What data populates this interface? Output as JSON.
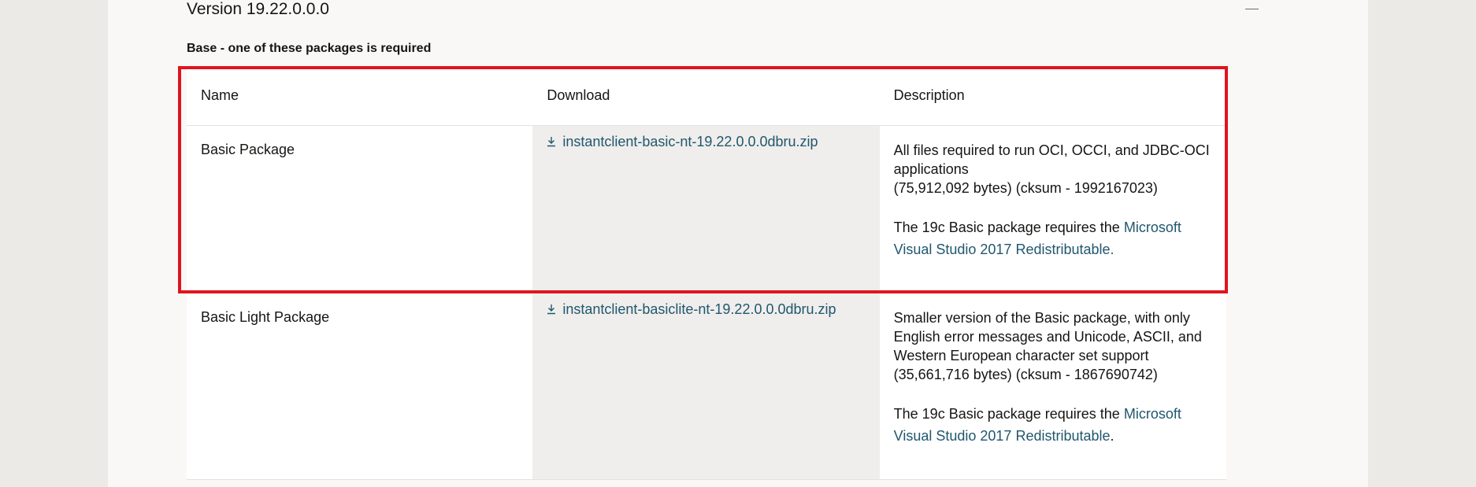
{
  "version": {
    "title": "Version 19.22.0.0.0"
  },
  "section": {
    "heading": "Base - one of these packages is required"
  },
  "table": {
    "headers": {
      "name": "Name",
      "download": "Download",
      "description": "Description"
    },
    "rows": [
      {
        "name": "Basic Package",
        "download": "instantclient-basic-nt-19.22.0.0.0dbru.zip",
        "description_lines": [
          "All files required to run OCI, OCCI, and JDBC-OCI",
          "applications",
          "(75,912,092 bytes) (cksum - 1992167023)"
        ],
        "requirement_prefix": "The 19c Basic package requires the ",
        "requirement_link": "Microsoft Visual Studio 2017 Redistributable.",
        "requirement_suffix": ""
      },
      {
        "name": "Basic Light Package",
        "download": "instantclient-basiclite-nt-19.22.0.0.0dbru.zip",
        "description_lines": [
          "Smaller version of the Basic package, with only",
          "English error messages and Unicode, ASCII, and",
          "Western European character set support",
          "(35,661,716 bytes) (cksum - 1867690742)"
        ],
        "requirement_prefix": "The 19c Basic package requires the ",
        "requirement_link": "Microsoft Visual Studio 2017 Redistributable",
        "requirement_suffix": "."
      }
    ]
  },
  "colors": {
    "link": "#21576e",
    "highlight_border": "#e0141e",
    "download_column_bg": "#efeeec"
  },
  "icons": {
    "collapse": "minus-icon",
    "download": "download-icon"
  }
}
